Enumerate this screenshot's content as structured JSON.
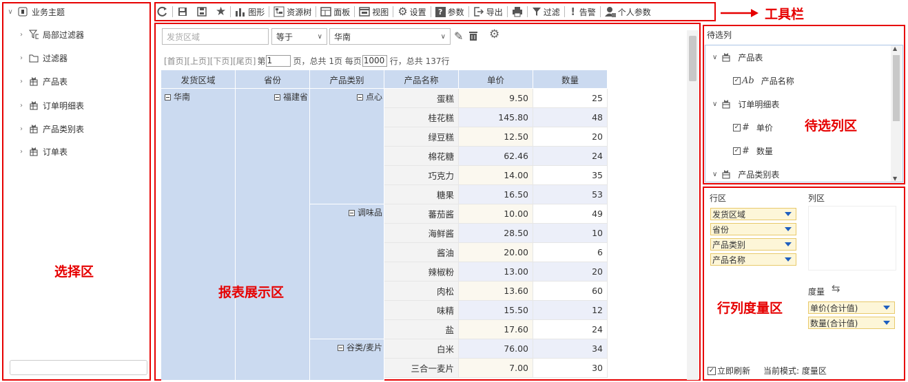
{
  "tree": {
    "root": "业务主题",
    "items": [
      "局部过滤器",
      "过滤器",
      "产品表",
      "订单明细表",
      "产品类别表",
      "订单表"
    ]
  },
  "toolbar": {
    "items": [
      "图形",
      "资源树",
      "面板",
      "视图",
      "设置",
      "参数",
      "导出",
      "过滤",
      "告警",
      "个人参数"
    ]
  },
  "filter": {
    "field_placeholder": "发货区域",
    "operator": "等于",
    "value": "华南"
  },
  "pager": {
    "first": "[首页]",
    "prev": "[上页]",
    "next": "[下页]",
    "last": "[尾页]",
    "page_prefix": "第",
    "page_value": "1",
    "page_mid": "页，总共 1页 每页",
    "page_size": "1000",
    "page_suffix": "行，总共 137行"
  },
  "table": {
    "headers": [
      "发货区域",
      "省份",
      "产品类别",
      "产品名称",
      "单价",
      "数量"
    ],
    "region": "华南",
    "province": "福建省",
    "categories": [
      "点心",
      "调味品",
      "谷类/麦片"
    ],
    "rows": [
      {
        "name": "蛋糕",
        "price": "9.50",
        "qty": "25"
      },
      {
        "name": "桂花糕",
        "price": "145.80",
        "qty": "48"
      },
      {
        "name": "绿豆糕",
        "price": "12.50",
        "qty": "20"
      },
      {
        "name": "棉花糖",
        "price": "62.46",
        "qty": "24"
      },
      {
        "name": "巧克力",
        "price": "14.00",
        "qty": "35"
      },
      {
        "name": "糖果",
        "price": "16.50",
        "qty": "53"
      },
      {
        "name": "蕃茄酱",
        "price": "10.00",
        "qty": "49"
      },
      {
        "name": "海鲜酱",
        "price": "28.50",
        "qty": "10"
      },
      {
        "name": "酱油",
        "price": "20.00",
        "qty": "6"
      },
      {
        "name": "辣椒粉",
        "price": "13.00",
        "qty": "20"
      },
      {
        "name": "肉松",
        "price": "13.60",
        "qty": "60"
      },
      {
        "name": "味精",
        "price": "15.50",
        "qty": "12"
      },
      {
        "name": "盐",
        "price": "17.60",
        "qty": "24"
      },
      {
        "name": "白米",
        "price": "76.00",
        "qty": "34"
      },
      {
        "name": "三合一麦片",
        "price": "7.00",
        "qty": "30"
      }
    ]
  },
  "candidates": {
    "title": "待选列",
    "items": [
      {
        "label": "产品表",
        "level": 0
      },
      {
        "label": "产品名称",
        "level": 1
      },
      {
        "label": "订单明细表",
        "level": 0
      },
      {
        "label": "单价",
        "level": 1
      },
      {
        "label": "数量",
        "level": 1
      },
      {
        "label": "产品类别表",
        "level": 0
      }
    ]
  },
  "zones": {
    "row_label": "行区",
    "col_label": "列区",
    "measure_label": "度量",
    "row_chips": [
      "发货区域",
      "省份",
      "产品类别",
      "产品名称"
    ],
    "measure_chips": [
      "单价(合计值)",
      "数量(合计值)"
    ],
    "refresh_label": "立即刷新",
    "mode_label": "当前模式: 度量区"
  },
  "annotations": {
    "toolbar": "工具栏",
    "select": "选择区",
    "report": "报表展示区",
    "candidate": "待选列区",
    "measure": "行列度量区"
  },
  "colors": {
    "annotation": "#e60000",
    "header_bg": "#cbdaf0",
    "chip_bg": "#fdf6d8"
  }
}
